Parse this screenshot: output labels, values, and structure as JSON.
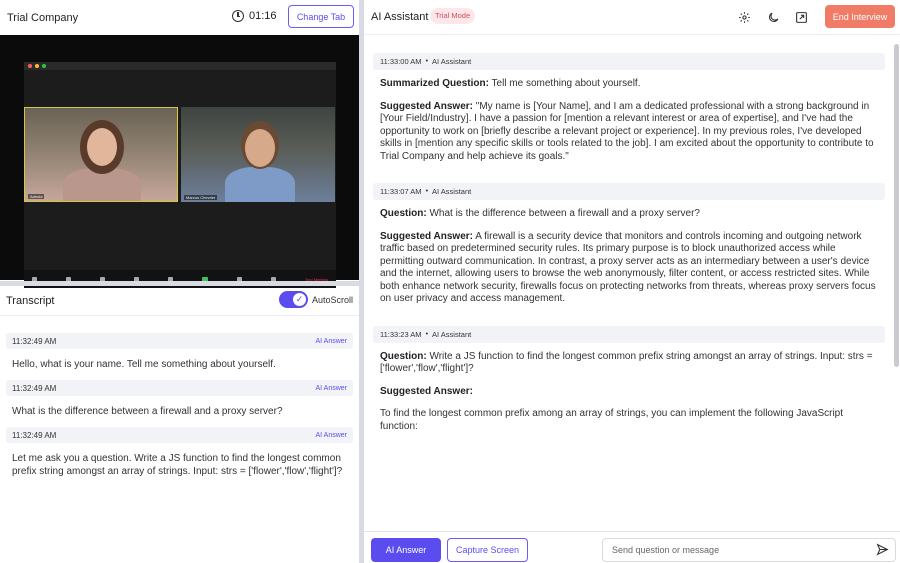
{
  "left": {
    "company": "Trial Company",
    "timer": "01:16",
    "change_tab": "Change Tab",
    "video": {
      "participant1": "Adeola",
      "participant2": "Marcus Chevrier",
      "end_label": "End Meeting"
    },
    "transcript": {
      "title": "Transcript",
      "autoscroll": "AutoScroll",
      "autoscroll_on": true,
      "items": [
        {
          "time": "11:32:49 AM",
          "tag": "AI Answer",
          "text": "Hello, what is your name. Tell me something about yourself."
        },
        {
          "time": "11:32:49 AM",
          "tag": "AI Answer",
          "text": "What is the difference between a firewall and a proxy server?"
        },
        {
          "time": "11:32:49 AM",
          "tag": "AI Answer",
          "text": "Let me ask you a question. Write a JS function to find the longest common prefix string amongst an array of strings. Input: strs = ['flower','flow','flight']?"
        }
      ]
    }
  },
  "right": {
    "title": "AI Assistant",
    "badge": "Trial Mode",
    "end_interview": "End Interview",
    "icons": [
      "gear-icon",
      "moon-icon",
      "popout-icon"
    ],
    "messages": [
      {
        "time": "11:33:00 AM",
        "sender": "AI Assistant",
        "q_label": "Summarized Question:",
        "q_text": "Tell me something about yourself.",
        "a_label": "Suggested Answer:",
        "a_text": "\"My name is [Your Name], and I am a dedicated professional with a strong background in [Your Field/Industry]. I have a passion for [mention a relevant interest or area of expertise], and I've had the opportunity to work on [briefly describe a relevant project or experience]. In my previous roles, I've developed skills in [mention any specific skills or tools related to the job]. I am excited about the opportunity to contribute to Trial Company and help achieve its goals.\""
      },
      {
        "time": "11:33:07 AM",
        "sender": "AI Assistant",
        "q_label": "Question:",
        "q_text": "What is the difference between a firewall and a proxy server?",
        "a_label": "Suggested Answer:",
        "a_text": "A firewall is a security device that monitors and controls incoming and outgoing network traffic based on predetermined security rules. Its primary purpose is to block unauthorized access while permitting outward communication. In contrast, a proxy server acts as an intermediary between a user's device and the internet, allowing users to browse the web anonymously, filter content, or access restricted sites. While both enhance network security, firewalls focus on protecting networks from threats, whereas proxy servers focus on user privacy and access management."
      },
      {
        "time": "11:33:23 AM",
        "sender": "AI Assistant",
        "q_label": "Question:",
        "q_text": "Write a JS function to find the longest common prefix string amongst an array of strings. Input: strs = ['flower','flow','flight']?",
        "a_label": "Suggested Answer:",
        "a_text": "",
        "extra": "To find the longest common prefix among an array of strings, you can implement the following JavaScript function:"
      }
    ],
    "footer": {
      "ai_answer": "AI Answer",
      "capture_screen": "Capture Screen",
      "input_placeholder": "Send question or message"
    }
  }
}
